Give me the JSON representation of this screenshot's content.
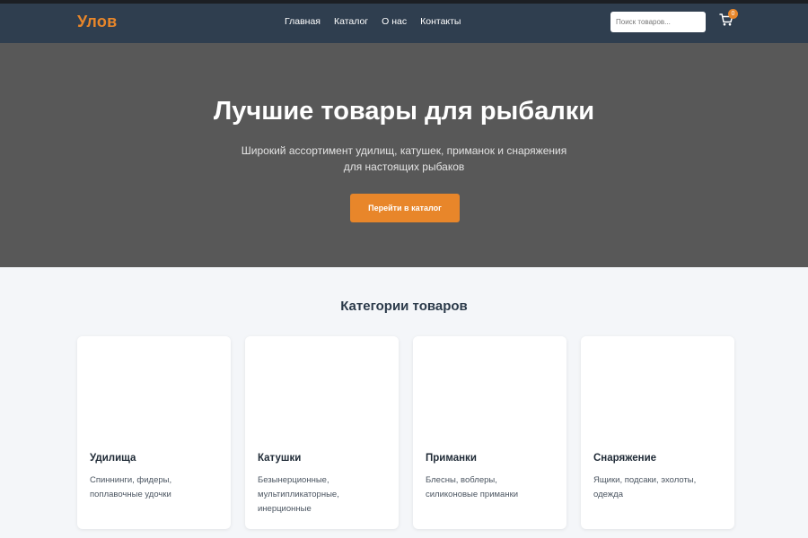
{
  "header": {
    "logo": "Улов",
    "nav": [
      "Главная",
      "Каталог",
      "О нас",
      "Контакты"
    ],
    "search_placeholder": "Поиск товаров...",
    "cart_count": "0",
    "cart_icon": "cart-icon",
    "accent_color": "#e8862a",
    "bg_color": "#2f3e4f"
  },
  "hero": {
    "title": "Лучшие товары для рыбалки",
    "subtitle_line1": "Широкий ассортимент удилищ, катушек, приманок и снаряжения",
    "subtitle_line2": "для настоящих рыбаков",
    "button": "Перейти в каталог"
  },
  "categories": {
    "title": "Категории товаров",
    "items": [
      {
        "title": "Удилища",
        "desc_lines": [
          "Спиннинги, фидеры,",
          "поплавочные удочки"
        ]
      },
      {
        "title": "Катушки",
        "desc_lines": [
          "Безынерционные,",
          "мультипликаторные,",
          "инерционные"
        ]
      },
      {
        "title": "Приманки",
        "desc_lines": [
          "Блесны, воблеры,",
          "силиконовые приманки"
        ]
      },
      {
        "title": "Снаряжение",
        "desc_lines": [
          "Ящики, подсаки, эхолоты,",
          "одежда"
        ]
      }
    ]
  }
}
